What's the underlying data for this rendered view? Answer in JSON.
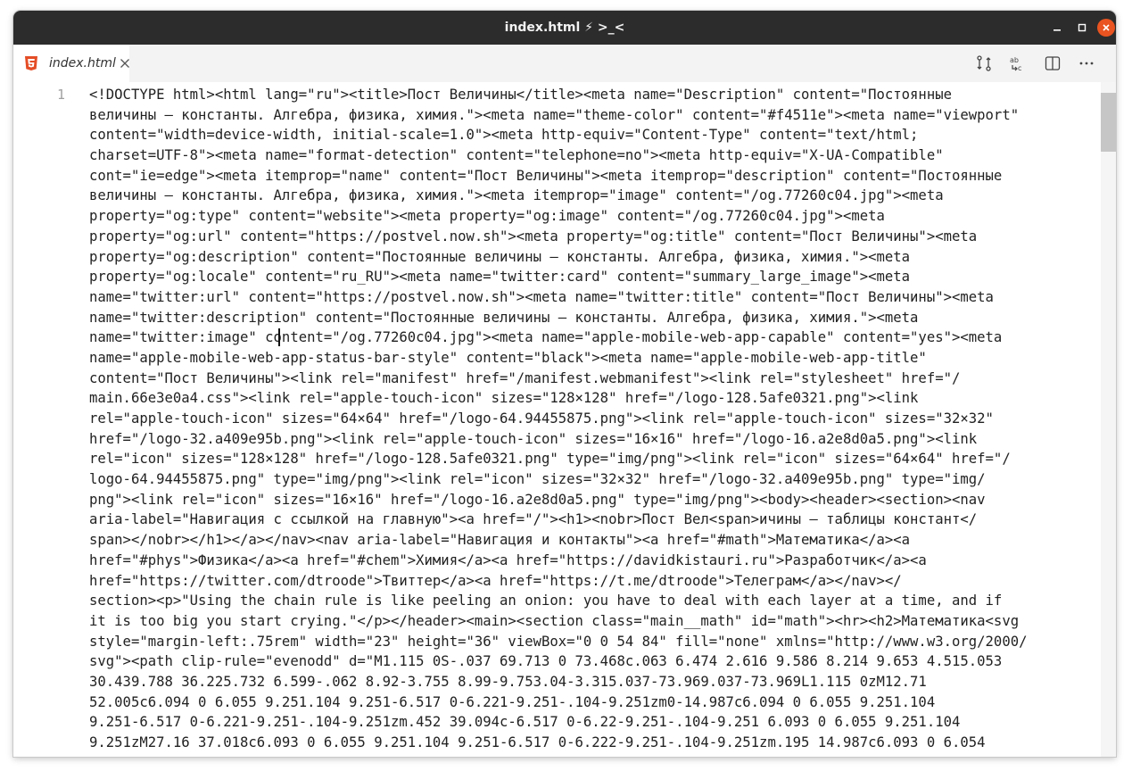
{
  "window": {
    "title": "index.html ⚡ >_<",
    "controls": {
      "minimize_icon": "minimize-icon",
      "maximize_icon": "maximize-icon",
      "close_icon": "close-icon"
    }
  },
  "tabs": [
    {
      "label": "index.html",
      "icon": "html5-icon",
      "active": true,
      "close_icon": "close-icon"
    }
  ],
  "toolbar": {
    "icons": [
      "source-control-compare-icon",
      "find-replace-icon",
      "split-editor-icon",
      "more-actions-icon"
    ]
  },
  "editor": {
    "line_number": "1",
    "lines": [
      "<!DOCTYPE html><html lang=\"ru\"><title>Пост Величины</title><meta name=\"Description\" content=\"Постоянные",
      "величины — константы. Алгебра, физика, химия.\"><meta name=\"theme-color\" content=\"#f4511e\"><meta name=\"viewport\"",
      "content=\"width=device-width, initial-scale=1.0\"><meta http-equiv=\"Content-Type\" content=\"text/html;",
      "charset=UTF-8\"><meta name=\"format-detection\" content=\"telephone=no\"><meta http-equiv=\"X-UA-Compatible\"",
      "cont=\"ie=edge\"><meta itemprop=\"name\" content=\"Пост Величины\"><meta itemprop=\"description\" content=\"Постоянные",
      "величины — константы. Алгебра, физика, химия.\"><meta itemprop=\"image\" content=\"/og.77260c04.jpg\"><meta",
      "property=\"og:type\" content=\"website\"><meta property=\"og:image\" content=\"/og.77260c04.jpg\"><meta",
      "property=\"og:url\" content=\"https://postvel.now.sh\"><meta property=\"og:title\" content=\"Пост Величины\"><meta",
      "property=\"og:description\" content=\"Постоянные величины — константы. Алгебра, физика, химия.\"><meta",
      "property=\"og:locale\" content=\"ru_RU\"><meta name=\"twitter:card\" content=\"summary_large_image\"><meta",
      "name=\"twitter:url\" content=\"https://postvel.now.sh\"><meta name=\"twitter:title\" content=\"Пост Величины\"><meta",
      "name=\"twitter:description\" content=\"Постоянные величины — константы. Алгебра, физика, химия.\"><meta",
      "name=\"twitter:image\" content=\"/og.77260c04.jpg\"><meta name=\"apple-mobile-web-app-capable\" content=\"yes\"><meta",
      "name=\"apple-mobile-web-app-status-bar-style\" content=\"black\"><meta name=\"apple-mobile-web-app-title\"",
      "content=\"Пост Величины\"><link rel=\"manifest\" href=\"/manifest.webmanifest\"><link rel=\"stylesheet\" href=\"/",
      "main.66e3e0a4.css\"><link rel=\"apple-touch-icon\" sizes=\"128×128\" href=\"/logo-128.5afe0321.png\"><link",
      "rel=\"apple-touch-icon\" sizes=\"64×64\" href=\"/logo-64.94455875.png\"><link rel=\"apple-touch-icon\" sizes=\"32×32\"",
      "href=\"/logo-32.a409e95b.png\"><link rel=\"apple-touch-icon\" sizes=\"16×16\" href=\"/logo-16.a2e8d0a5.png\"><link",
      "rel=\"icon\" sizes=\"128×128\" href=\"/logo-128.5afe0321.png\" type=\"img/png\"><link rel=\"icon\" sizes=\"64×64\" href=\"/",
      "logo-64.94455875.png\" type=\"img/png\"><link rel=\"icon\" sizes=\"32×32\" href=\"/logo-32.a409e95b.png\" type=\"img/",
      "png\"><link rel=\"icon\" sizes=\"16×16\" href=\"/logo-16.a2e8d0a5.png\" type=\"img/png\"><body><header><section><nav",
      "aria-label=\"Навигация с ссылкой на главную\"><a href=\"/\"><h1><nobr>Пост Вел<span>ичины — таблицы констант</",
      "span></nobr></h1></a></nav><nav aria-label=\"Навигация и контакты\"><a href=\"#math\">Математика</a><a",
      "href=\"#phys\">Физика</a><a href=\"#chem\">Химия</a><a href=\"https://davidkistauri.ru\">Разработчик</a><a",
      "href=\"https://twitter.com/dtroode\">Твиттер</a><a href=\"https://t.me/dtroode\">Телеграм</a></nav></",
      "section><p>\"Using the chain rule is like peeling an onion: you have to deal with each layer at a time, and if",
      "it is too big you start crying.\"</p></header><main><section class=\"main__math\" id=\"math\"><hr><h2>Математика<svg",
      "style=\"margin-left:.75rem\" width=\"23\" height=\"36\" viewBox=\"0 0 54 84\" fill=\"none\" xmlns=\"http://www.w3.org/2000/",
      "svg\"><path clip-rule=\"evenodd\" d=\"M1.115 0S-.037 69.713 0 73.468c.063 6.474 2.616 9.586 8.214 9.653 4.515.053",
      "30.439.788 36.225.732 6.599-.062 8.92-3.755 8.99-9.753.04-3.315.037-73.969.037-73.969L1.115 0zM12.71",
      "52.005c6.094 0 6.055 9.251.104 9.251-6.517 0-6.221-9.251-.104-9.251zm0-14.987c6.094 0 6.055 9.251.104",
      "9.251-6.517 0-6.221-9.251-.104-9.251zm.452 39.094c-6.517 0-6.22-9.251-.104-9.251 6.093 0 6.055 9.251.104",
      "9.251zM27.16 37.018c6.093 0 6.055 9.251.104 9.251-6.517 0-6.222-9.251-.104-9.251zm.195 14.987c6.093 0 6.054"
    ]
  }
}
